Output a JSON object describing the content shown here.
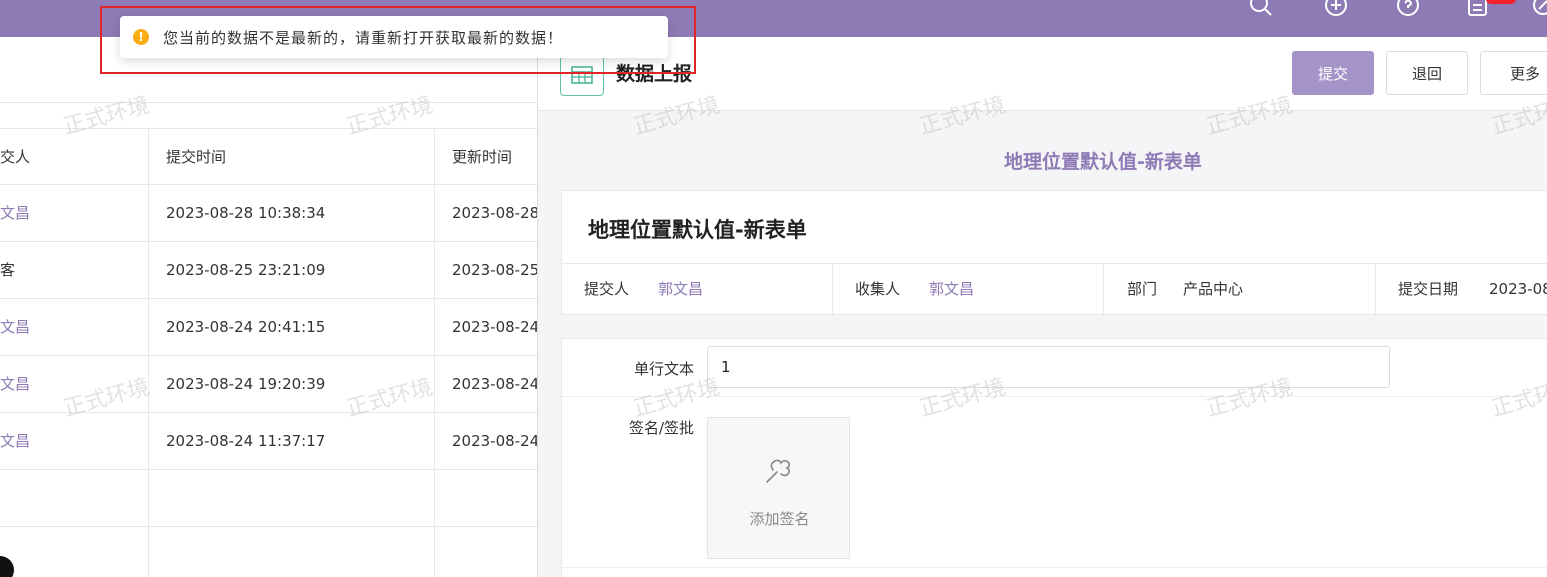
{
  "toast": {
    "message": "您当前的数据不是最新的，请重新打开获取最新的数据！",
    "icon": "warning-icon",
    "icon_glyph": "!",
    "color": "#faad14"
  },
  "watermark": "正式环境",
  "colors": {
    "brand": "#8e7bb5",
    "primary_button": "#a594c8",
    "highlight": "#e0242a"
  },
  "topbar": {
    "icons": [
      "search-icon",
      "add-icon",
      "help-icon",
      "document-icon"
    ]
  },
  "table": {
    "columns": [
      "交人",
      "提交时间",
      "更新时间"
    ],
    "rows": [
      {
        "submitter": "文昌",
        "submit_time": "2023-08-28 10:38:34",
        "update_time": "2023-08-28"
      },
      {
        "submitter": "客",
        "submit_time": "2023-08-25 23:21:09",
        "update_time": "2023-08-25"
      },
      {
        "submitter": "文昌",
        "submit_time": "2023-08-24 20:41:15",
        "update_time": "2023-08-24"
      },
      {
        "submitter": "文昌",
        "submit_time": "2023-08-24 19:20:39",
        "update_time": "2023-08-24"
      },
      {
        "submitter": "文昌",
        "submit_time": "2023-08-24 11:37:17",
        "update_time": "2023-08-24"
      }
    ]
  },
  "form_panel": {
    "title": "数据上报",
    "buttons": {
      "submit": "提交",
      "back": "退回",
      "more": "更多"
    },
    "heading": "地理位置默认值-新表单",
    "card_title": "地理位置默认值-新表单",
    "meta": {
      "submitter_label": "提交人",
      "submitter_value": "郭文昌",
      "collector_label": "收集人",
      "collector_value": "郭文昌",
      "dept_label": "部门",
      "dept_value": "产品中心",
      "date_label": "提交日期",
      "date_value": "2023-08"
    },
    "fields": {
      "single_text_label": "单行文本",
      "single_text_value": "1",
      "signature_label": "签名/签批",
      "signature_button": "添加签名"
    }
  }
}
